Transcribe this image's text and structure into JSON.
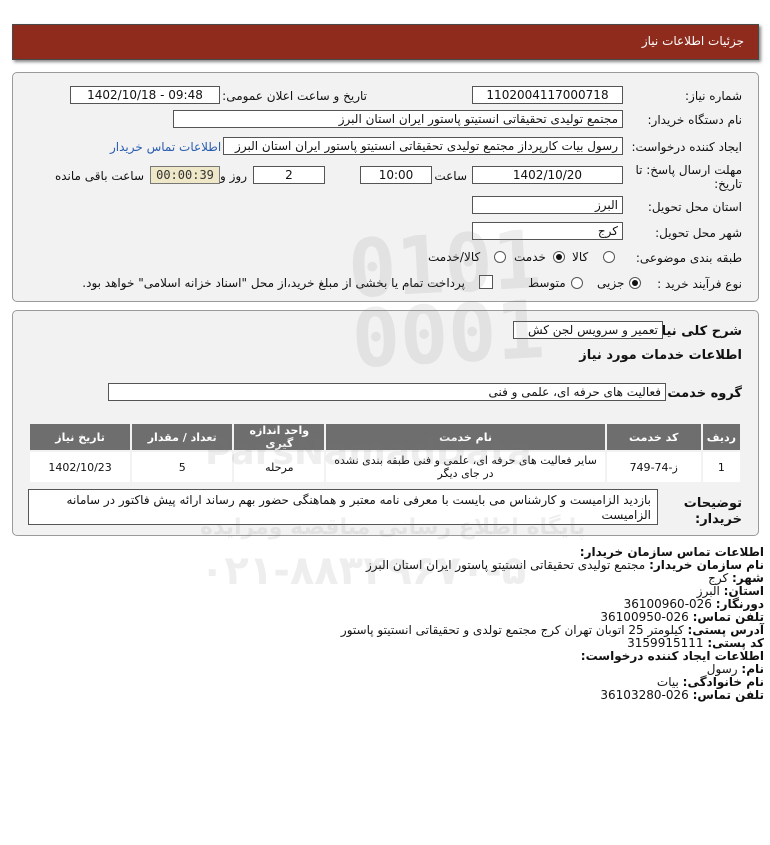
{
  "page": {
    "title": "جزئیات اطلاعات نیاز"
  },
  "form": {
    "need_number_label": "شماره نیاز:",
    "need_number": "1102004117000718",
    "announce_label": "تاریخ و ساعت اعلان عمومی:",
    "announce_value": "1402/10/18 - 09:48",
    "buyer_label": "نام دستگاه خریدار:",
    "buyer_value": "مجتمع تولیدی تحقیقاتی انستیتو پاستور ایران استان البرز",
    "creator_label": "ایجاد کننده درخواست:",
    "creator_value": "رسول بیات کارپرداز مجتمع تولیدی تحقیقاتی انستیتو پاستور ایران استان البرز",
    "contact_link": "اطلاعات تماس خریدار",
    "deadline_label_1": "مهلت ارسال پاسخ: تا",
    "deadline_label_2": "تاریخ:",
    "deadline_date": "1402/10/20",
    "time_label": "ساعت",
    "deadline_time": "10:00",
    "days_value": "2",
    "days_label": "روز و",
    "remaining_timer": "00:00:39",
    "remaining_label": "ساعت باقی مانده",
    "province_label": "استان محل تحویل:",
    "province_value": "البرز",
    "city_label": "شهر محل تحویل:",
    "city_value": "کرج",
    "category_label": "طبقه بندی موضوعی:",
    "category_options": [
      {
        "label": "کالا",
        "checked": false
      },
      {
        "label": "خدمت",
        "checked": true
      },
      {
        "label": "کالا/خدمت",
        "checked": false
      }
    ],
    "process_label": "نوع فرآیند خرید :",
    "process_options": [
      {
        "label": "جزیی",
        "checked": true
      },
      {
        "label": "متوسط",
        "checked": false
      }
    ],
    "payment_text": "پرداخت تمام یا بخشی از مبلغ خرید،از محل \"اسناد خزانه اسلامی\" خواهد بود."
  },
  "need": {
    "summary_label": "شرح کلی نیاز:",
    "summary_value": "تعمیر و سرویس لجن کش",
    "services_heading": "اطلاعات خدمات مورد نیاز",
    "group_label": "گروه خدمت:",
    "group_value": "فعالیت های حرفه ای، علمی و فنی",
    "table": {
      "headers": [
        "ردیف",
        "کد خدمت",
        "نام خدمت",
        "واحد اندازه گیری",
        "تعداد / مقدار",
        "تاریخ نیاز"
      ],
      "rows": [
        [
          "1",
          "ز-74-749",
          "سایر فعالیت های حرفه ای، علمی و فنی طبقه بندی نشده در جای دیگر",
          "مرحله",
          "5",
          "1402/10/23"
        ]
      ]
    },
    "desc_label_1": "توضیحات",
    "desc_label_2": "خریدار:",
    "desc_value": "بازدید الزامیست و کارشناس می بایست با معرفی نامه معتبر و هماهنگی حضور بهم رساند ارائه پیش فاکتور در سامانه الزامیست"
  },
  "contact": {
    "title": "اطلاعات تماس سازمان خریدار:",
    "org_label": "نام سازمان خریدار:",
    "org_value": "مجتمع تولیدی تحقیقاتی انستیتو پاستور ایران استان البرز",
    "city_label": "شهر:",
    "city_value": "کرج",
    "province_label": "استان:",
    "province_value": "البرز",
    "fax_label": "دورنگار:",
    "fax_value": "026-36100960",
    "phone_label": "تلفن تماس:",
    "phone_value": "026-36100950",
    "address_label": "آدرس پستی:",
    "address_value": "کیلومتر 25 اتوبان تهران کرج مجتمع تولدی و تحقیقاتی انستیتو پاستور",
    "postal_label": "کد پستی:",
    "postal_value": "3159915111",
    "creator_title": "اطلاعات ایجاد کننده درخواست:",
    "first_label": "نام:",
    "first_value": "رسول",
    "last_label": "نام خانوادگی:",
    "last_value": "بیات",
    "creator_phone_label": "تلفن تماس:",
    "creator_phone_value": "026-36103280"
  },
  "watermark": {
    "brand": "ParsNamadData",
    "line1": "پایگاه اطلاع رسانی مناقصه ومزایده",
    "phone": "۰۲۱-۸۸۳۴۹۶۷۰-۵"
  }
}
